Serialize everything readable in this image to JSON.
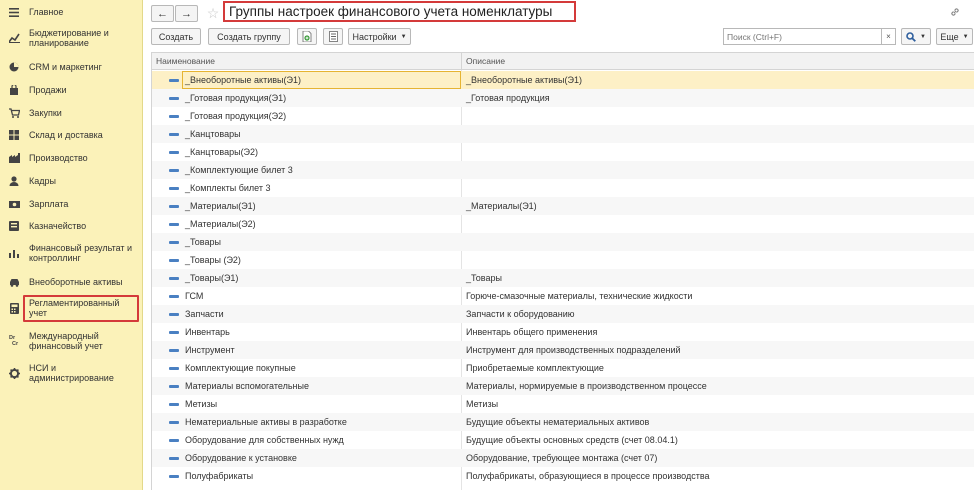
{
  "sidebar": {
    "items": [
      {
        "label": "Главное",
        "icon": "menu-icon"
      },
      {
        "label": "Бюджетирование и планирование",
        "icon": "chart-line-icon"
      },
      {
        "label": "CRM и маркетинг",
        "icon": "pie-chart-icon"
      },
      {
        "label": "Продажи",
        "icon": "shopping-bag-icon"
      },
      {
        "label": "Закупки",
        "icon": "cart-icon"
      },
      {
        "label": "Склад и доставка",
        "icon": "warehouse-icon"
      },
      {
        "label": "Производство",
        "icon": "factory-icon"
      },
      {
        "label": "Кадры",
        "icon": "person-icon"
      },
      {
        "label": "Зарплата",
        "icon": "money-icon"
      },
      {
        "label": "Казначейство",
        "icon": "treasury-icon"
      },
      {
        "label": "Финансовый результат и контроллинг",
        "icon": "bar-chart-icon"
      },
      {
        "label": "Внеоборотные активы",
        "icon": "car-icon"
      },
      {
        "label": "Регламентированный учет",
        "icon": "calculator-icon"
      },
      {
        "label": "Международный финансовый учет",
        "icon": "dr-cr-icon"
      },
      {
        "label": "НСИ и администрирование",
        "icon": "gear-icon"
      }
    ]
  },
  "header": {
    "title": "Группы настроек финансового учета номенклатуры",
    "back": "←",
    "forward": "→",
    "star": "☆",
    "link": "🔗"
  },
  "toolbar": {
    "create": "Создать",
    "create_group": "Создать группу",
    "settings": "Настройки",
    "search_placeholder": "Поиск (Ctrl+F)",
    "clear": "×",
    "more": "Еще"
  },
  "table": {
    "columns": [
      "Наименование",
      "Описание"
    ],
    "rows": [
      {
        "name": "_Внеоборотные активы(Э1)",
        "desc": "_Внеоборотные активы(Э1)"
      },
      {
        "name": "_Готовая продукция(Э1)",
        "desc": "_Готовая продукция"
      },
      {
        "name": "_Готовая продукция(Э2)",
        "desc": ""
      },
      {
        "name": "_Канцтовары",
        "desc": ""
      },
      {
        "name": "_Канцтовары(Э2)",
        "desc": ""
      },
      {
        "name": "_Комплектующие билет 3",
        "desc": ""
      },
      {
        "name": "_Комплекты билет 3",
        "desc": ""
      },
      {
        "name": "_Материалы(Э1)",
        "desc": "_Материалы(Э1)"
      },
      {
        "name": "_Материалы(Э2)",
        "desc": ""
      },
      {
        "name": "_Товары",
        "desc": ""
      },
      {
        "name": "_Товары (Э2)",
        "desc": ""
      },
      {
        "name": "_Товары(Э1)",
        "desc": "_Товары"
      },
      {
        "name": "ГСМ",
        "desc": "Горюче-смазочные материалы, технические жидкости"
      },
      {
        "name": "Запчасти",
        "desc": "Запчасти к оборудованию"
      },
      {
        "name": "Инвентарь",
        "desc": "Инвентарь общего применения"
      },
      {
        "name": "Инструмент",
        "desc": "Инструмент для производственных подразделений"
      },
      {
        "name": "Комплектующие покупные",
        "desc": "Приобретаемые комплектующие"
      },
      {
        "name": "Материалы вспомогательные",
        "desc": "Материалы, нормируемые в производственном процессе"
      },
      {
        "name": "Метизы",
        "desc": "Метизы"
      },
      {
        "name": "Нематериальные активы в разработке",
        "desc": "Будущие объекты нематериальных активов"
      },
      {
        "name": "Оборудование для собственных нужд",
        "desc": "Будущие объекты основных средств (счет 08.04.1)"
      },
      {
        "name": "Оборудование к установке",
        "desc": "Оборудование, требующее монтажа (счет 07)"
      },
      {
        "name": "Полуфабрикаты",
        "desc": "Полуфабрикаты, образующиеся в процессе производства"
      }
    ]
  },
  "colors": {
    "sidebar_bg": "#fbf2b9",
    "highlight_red": "#d43a3a",
    "selected_row": "#fdf0c6",
    "row_marker": "#4a80c2"
  }
}
